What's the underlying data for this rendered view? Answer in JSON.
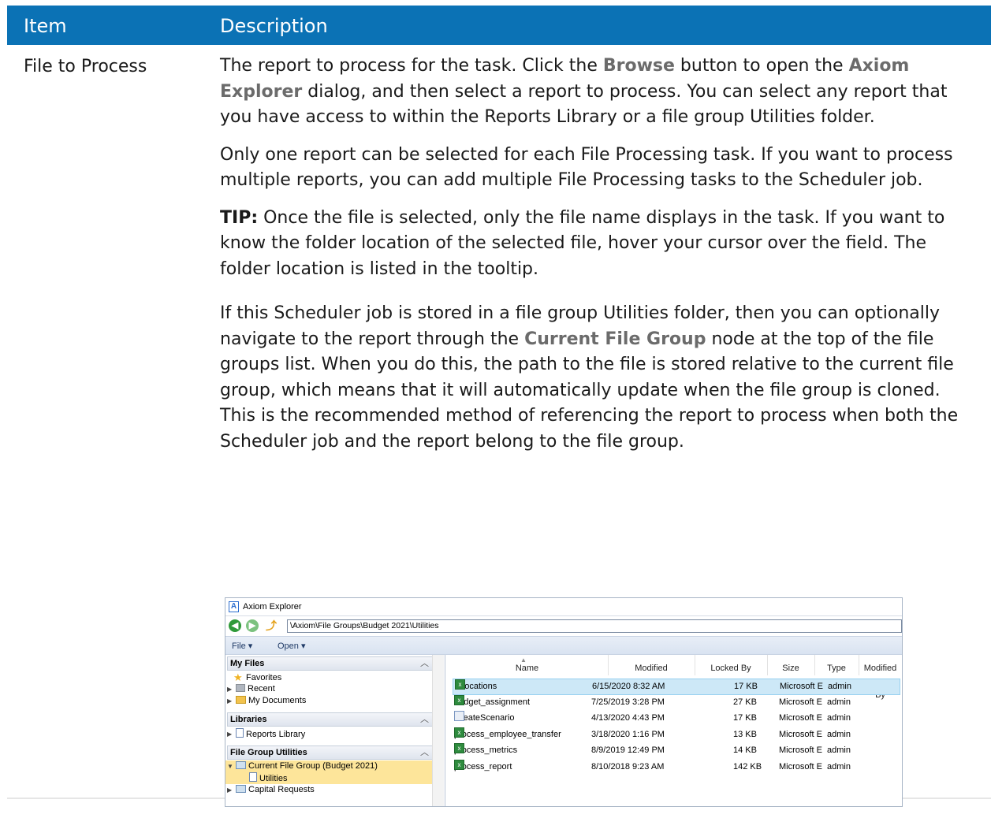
{
  "table": {
    "headers": {
      "item": "Item",
      "description": "Description"
    },
    "item_label": "File to Process",
    "p1": {
      "a": "The report to process for the task. Click the ",
      "browse": "Browse",
      "b": " button to open the ",
      "axiom_explorer": "Axiom Explorer",
      "c": " dialog, and then select a report to process. You can select any report that you have access to within the Reports Library or a file group Utilities folder."
    },
    "p2": "Only one report can be selected for each File Processing task. If you want to process multiple reports, you can add multiple File Processing tasks to the Scheduler job.",
    "p3": {
      "tip": "TIP:",
      "text": " Once the file is selected, only the file name displays in the task. If you want to know the folder location of the selected file, hover your cursor over the field. The folder location is listed in the tooltip."
    },
    "p4": {
      "a": "If this Scheduler job is stored in a file group Utilities folder, then you can optionally navigate to the report through the ",
      "node": "Current File Group",
      "b": " node at the top of the file groups list. When you do this, the path to the file is stored relative to the current file group, which means that it will automatically update when the file group is cloned. This is the recommended method of referencing the report to process when both the Scheduler job and the report belong to the file group."
    }
  },
  "explorer": {
    "title": "Axiom Explorer",
    "logo_letter": "A",
    "address": "\\Axiom\\File Groups\\Budget 2021\\Utilities",
    "menu": {
      "file": "File ▾",
      "open": "Open ▾"
    },
    "sections": {
      "my_files": "My Files",
      "libraries": "Libraries",
      "file_group_utilities": "File Group Utilities"
    },
    "tree": {
      "favorites": "Favorites",
      "recent": "Recent",
      "my_documents": "My Documents",
      "reports_library": "Reports Library",
      "current_file_group": "Current File Group (Budget 2021)",
      "utilities": "Utilities",
      "capital_requests": "Capital Requests"
    },
    "columns": {
      "name": "Name",
      "modified": "Modified",
      "locked_by": "Locked By",
      "size": "Size",
      "type": "Type",
      "modified_by": "Modified By"
    },
    "files": [
      {
        "name": "Allocations",
        "modified": "6/15/2020 8:32 AM",
        "size": "17 KB",
        "type": "Microsoft E",
        "modified_by": "admin",
        "selected": true,
        "icon": "excel"
      },
      {
        "name": "budget_assignment",
        "modified": "7/25/2019 3:28 PM",
        "size": "27 KB",
        "type": "Microsoft E",
        "modified_by": "admin",
        "selected": false,
        "icon": "excel"
      },
      {
        "name": "CreateScenario",
        "modified": "4/13/2020 4:43 PM",
        "size": "17 KB",
        "type": "Microsoft E",
        "modified_by": "admin",
        "selected": false,
        "icon": "sheet"
      },
      {
        "name": "process_employee_transfer",
        "modified": "3/18/2020 1:16 PM",
        "size": "13 KB",
        "type": "Microsoft E",
        "modified_by": "admin",
        "selected": false,
        "icon": "excel"
      },
      {
        "name": "process_metrics",
        "modified": "8/9/2019 12:49 PM",
        "size": "14 KB",
        "type": "Microsoft E",
        "modified_by": "admin",
        "selected": false,
        "icon": "excel"
      },
      {
        "name": "process_report",
        "modified": "8/10/2018 9:23 AM",
        "size": "142 KB",
        "type": "Microsoft E",
        "modified_by": "admin",
        "selected": false,
        "icon": "excel"
      }
    ],
    "colors": {
      "header_blue": "#0b72b5",
      "highlight": "#fde59a",
      "selected_row": "#cde8f7",
      "arrow": "#f0a21f"
    }
  }
}
